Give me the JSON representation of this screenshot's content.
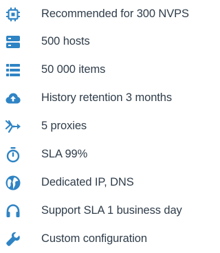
{
  "accent_color": "#2f84c4",
  "text_color": "#2f3d4a",
  "features": [
    {
      "icon": "cpu-chip-icon",
      "label": "Recommended for 300 NVPS"
    },
    {
      "icon": "server-stack-icon",
      "label": "500 hosts"
    },
    {
      "icon": "list-icon",
      "label": "50 000 items"
    },
    {
      "icon": "cloud-upload-icon",
      "label": "History retention 3 months"
    },
    {
      "icon": "proxy-arrows-icon",
      "label": "5 proxies"
    },
    {
      "icon": "stopwatch-icon",
      "label": "SLA 99%"
    },
    {
      "icon": "globe-icon",
      "label": "Dedicated IP, DNS"
    },
    {
      "icon": "headset-icon",
      "label": "Support SLA 1 business day"
    },
    {
      "icon": "wrench-icon",
      "label": "Custom configuration"
    }
  ]
}
